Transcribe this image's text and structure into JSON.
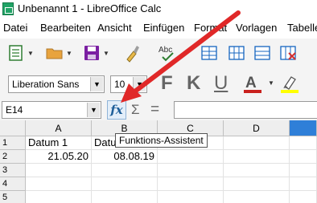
{
  "window": {
    "title": "Unbenannt 1 - LibreOffice Calc"
  },
  "menu": {
    "items": [
      "Datei",
      "Bearbeiten",
      "Ansicht",
      "Einfügen",
      "Format",
      "Vorlagen",
      "Tabelle"
    ]
  },
  "toolbar": {
    "font_name": "Liberation Sans",
    "font_size": "10",
    "bold_label": "F",
    "italic_label": "K",
    "underline_label": "U",
    "font_color": "#c9211e",
    "highlight_color": "#ffff00"
  },
  "formula_bar": {
    "name_box": "E14",
    "fx_label": "fx",
    "sum_label": "Σ",
    "equals_label": "=",
    "formula": ""
  },
  "tooltip": {
    "text": "Funktions-Assistent"
  },
  "sheet": {
    "columns": [
      "A",
      "B",
      "C",
      "D"
    ],
    "rows": [
      "1",
      "2",
      "3",
      "4",
      "5"
    ],
    "cells": {
      "A1": "Datum 1",
      "B1": "Datum 2",
      "A2": "21.05.20",
      "B2": "08.08.19"
    }
  },
  "annotation": {
    "arrow_color": "#e02828"
  }
}
